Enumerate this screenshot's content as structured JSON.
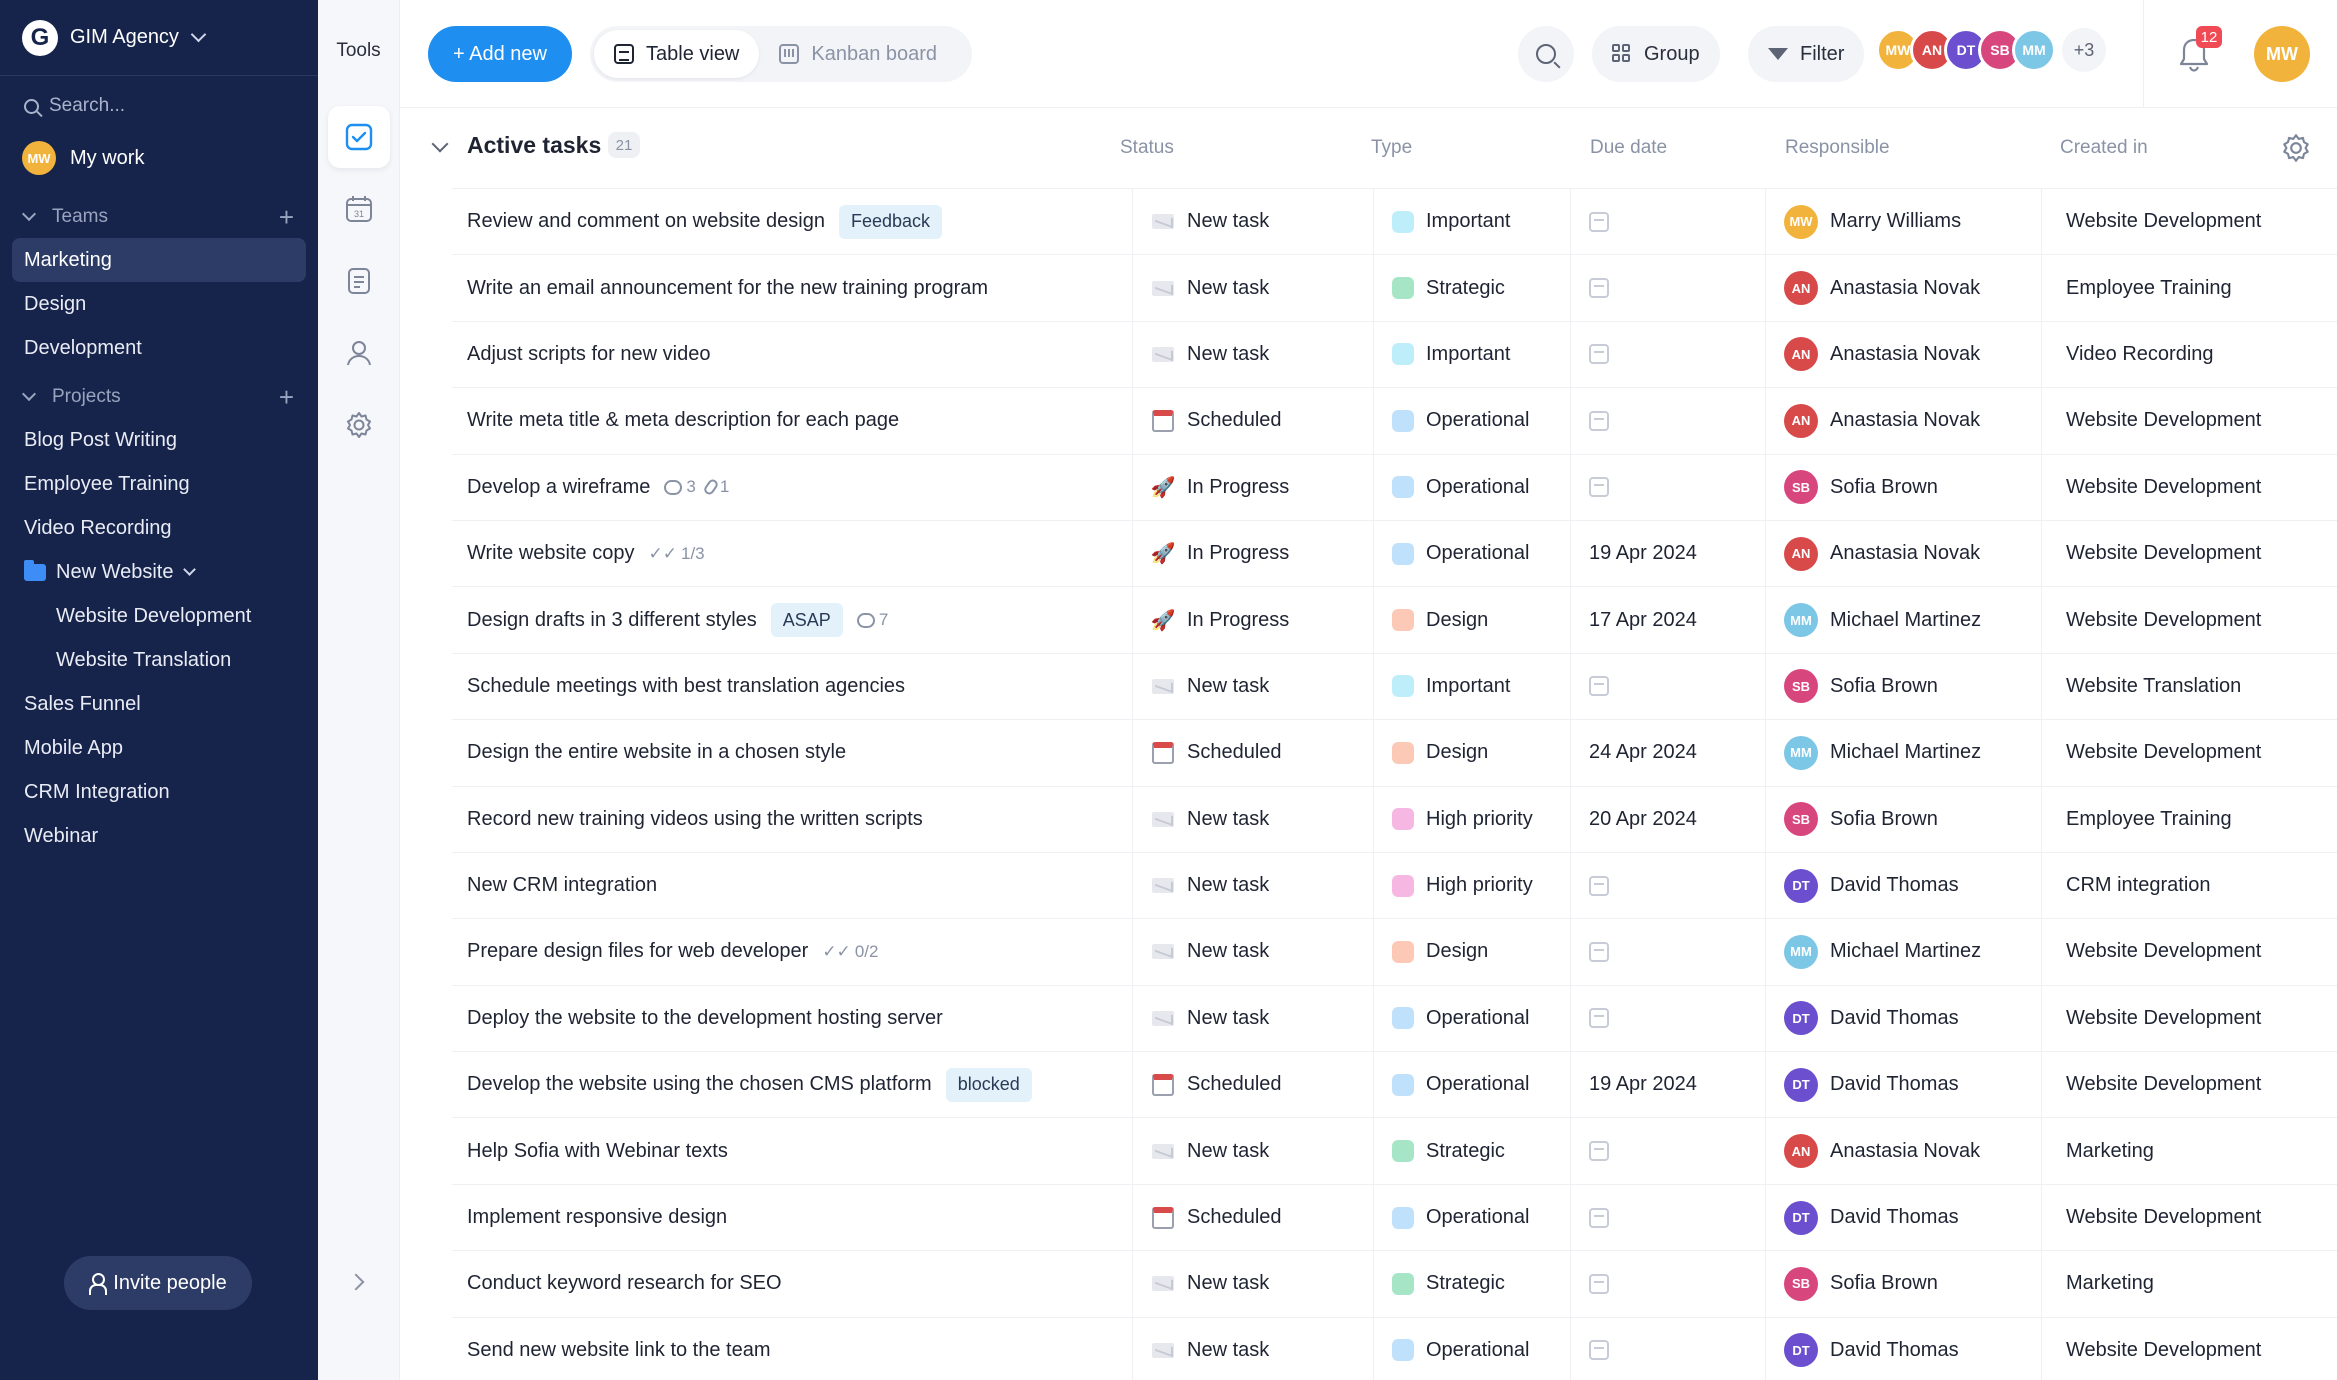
{
  "brand": {
    "name": "GIM Agency",
    "logo_letter": "G"
  },
  "sidebar": {
    "search_placeholder": "Search...",
    "my_work": "My work",
    "teams_label": "Teams",
    "teams": [
      "Marketing",
      "Design",
      "Development"
    ],
    "projects_label": "Projects",
    "projects": [
      "Blog Post Writing",
      "Employee Training",
      "Video Recording"
    ],
    "folder": {
      "name": "New Website",
      "children": [
        "Website Development",
        "Website Translation"
      ]
    },
    "projects_after": [
      "Sales Funnel",
      "Mobile App",
      "CRM Integration",
      "Webinar"
    ],
    "invite": "Invite people"
  },
  "tools": {
    "title": "Tools",
    "icons": [
      "tasks-icon",
      "calendar-icon",
      "notes-icon",
      "people-icon",
      "settings-icon"
    ],
    "calendar_day": "31"
  },
  "toolbar": {
    "add_new": "+ Add new",
    "table_view": "Table view",
    "kanban": "Kanban board",
    "group": "Group",
    "filter": "Filter",
    "more_count": "+3",
    "notifications": "12"
  },
  "group": {
    "title": "Active tasks",
    "count": "21"
  },
  "columns": {
    "status": "Status",
    "type": "Type",
    "due": "Due date",
    "responsible": "Responsible",
    "created": "Created in"
  },
  "colors": {
    "Important": "#bfeefb",
    "Strategic": "#a6e6c7",
    "Operational": "#bfe1fb",
    "Design": "#fbc9b5",
    "High priority": "#f6b8e3",
    "accent": "#1e8ef0"
  },
  "people": {
    "Marry Williams": "#f2b33d",
    "Anastasia Novak": "#d84a4a",
    "Sofia Brown": "#d8467e",
    "Michael Martinez": "#7cc6e6",
    "David Thomas": "#6b4fcf"
  },
  "rows": [
    {
      "name": "Review and comment on website design",
      "tag": "Feedback",
      "status": "New task",
      "type": "Important",
      "due": "",
      "resp": "Marry Williams",
      "created": "Website Development"
    },
    {
      "name": "Write an email announcement for the new training program",
      "status": "New task",
      "type": "Strategic",
      "due": "",
      "resp": "Anastasia Novak",
      "created": "Employee Training"
    },
    {
      "name": "Adjust scripts for new video",
      "status": "New task",
      "type": "Important",
      "due": "",
      "resp": "Anastasia Novak",
      "created": "Video Recording"
    },
    {
      "name": "Write meta title & meta description for each page",
      "status": "Scheduled",
      "type": "Operational",
      "due": "",
      "resp": "Anastasia Novak",
      "created": "Website Development"
    },
    {
      "name": "Develop a wireframe",
      "comments": "3",
      "attachments": "1",
      "status": "In Progress",
      "type": "Operational",
      "due": "",
      "resp": "Sofia Brown",
      "created": "Website Development"
    },
    {
      "name": "Write website copy",
      "checklist": "1/3",
      "status": "In Progress",
      "type": "Operational",
      "due": "19 Apr 2024",
      "resp": "Anastasia Novak",
      "created": "Website Development"
    },
    {
      "name": "Design drafts in 3 different styles",
      "tag": "ASAP",
      "comments": "7",
      "status": "In Progress",
      "type": "Design",
      "due": "17 Apr 2024",
      "resp": "Michael Martinez",
      "created": "Website Development"
    },
    {
      "name": "Schedule meetings with best translation agencies",
      "status": "New task",
      "type": "Important",
      "due": "",
      "resp": "Sofia Brown",
      "created": "Website Translation"
    },
    {
      "name": "Design the entire website in a chosen style",
      "status": "Scheduled",
      "type": "Design",
      "due": "24 Apr 2024",
      "resp": "Michael Martinez",
      "created": "Website Development"
    },
    {
      "name": "Record new training videos using the written scripts",
      "status": "New task",
      "type": "High priority",
      "due": "20 Apr 2024",
      "resp": "Sofia Brown",
      "created": "Employee Training"
    },
    {
      "name": "New CRM integration",
      "status": "New task",
      "type": "High priority",
      "due": "",
      "resp": "David Thomas",
      "created": "CRM integration"
    },
    {
      "name": "Prepare design files for web developer",
      "checklist": "0/2",
      "status": "New task",
      "type": "Design",
      "due": "",
      "resp": "Michael Martinez",
      "created": "Website Development"
    },
    {
      "name": "Deploy the website to the development hosting server",
      "status": "New task",
      "type": "Operational",
      "due": "",
      "resp": "David Thomas",
      "created": "Website Development"
    },
    {
      "name": "Develop the website using the chosen CMS platform",
      "tag": "blocked",
      "status": "Scheduled",
      "type": "Operational",
      "due": "19 Apr 2024",
      "resp": "David Thomas",
      "created": "Website Development"
    },
    {
      "name": "Help Sofia with Webinar texts",
      "status": "New task",
      "type": "Strategic",
      "due": "",
      "resp": "Anastasia Novak",
      "created": "Marketing"
    },
    {
      "name": "Implement responsive design",
      "status": "Scheduled",
      "type": "Operational",
      "due": "",
      "resp": "David Thomas",
      "created": "Website Development"
    },
    {
      "name": "Conduct keyword research for SEO",
      "status": "New task",
      "type": "Strategic",
      "due": "",
      "resp": "Sofia Brown",
      "created": "Marketing"
    },
    {
      "name": "Send new website link to the team",
      "status": "New task",
      "type": "Operational",
      "due": "",
      "resp": "David Thomas",
      "created": "Website Development"
    }
  ]
}
